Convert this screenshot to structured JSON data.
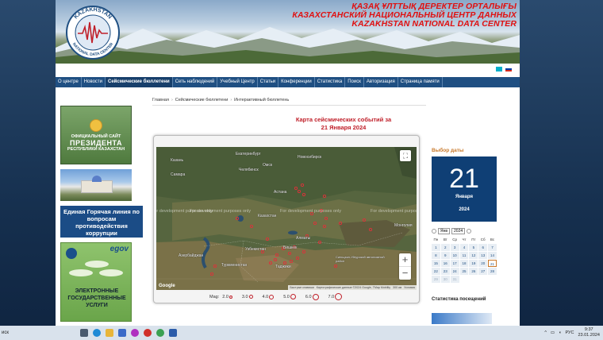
{
  "header": {
    "title_kz": "ҚАЗАҚ ҰЛТТЫҚ ДЕРЕКТЕР ОРТАЛЫҒЫ",
    "title_ru": "КАЗАХСТАНСКИЙ НАЦИОНАЛЬНЫЙ ЦЕНТР ДАННЫХ",
    "title_en": "KAZAKHSTAN NATIONAL DATA CENTER",
    "logo_top": "KAZAKHSTAN",
    "logo_bottom": "NATIONAL DATA CENTER"
  },
  "nav": {
    "items": [
      {
        "label": "О центре"
      },
      {
        "label": "Новости"
      },
      {
        "label": "Сейсмические бюллетени"
      },
      {
        "label": "Сеть наблюдений"
      },
      {
        "label": "Учебный Центр"
      },
      {
        "label": "Статьи"
      },
      {
        "label": "Конференции"
      },
      {
        "label": "Статистика"
      },
      {
        "label": "Поиск"
      },
      {
        "label": "Авторизация"
      },
      {
        "label": "Страница памяти"
      }
    ]
  },
  "breadcrumb": {
    "home": "Главная",
    "section": "Сейсмические бюллетени",
    "current": "Интерактивный бюллетень"
  },
  "map_title": {
    "line1": "Карта сейсмических событий за",
    "line2": "21 Января 2024"
  },
  "map": {
    "watermark": "For development purposes only",
    "labels": {
      "kazakhstan": "Казахстан",
      "astana": "Астана",
      "uzbekistan": "Узбекистан",
      "turkmenistan": "Туркменистан",
      "azerbaijan": "Азербайджан",
      "tajikistan": "Таджики",
      "almaty": "Алматы",
      "bishkek": "Бишкек",
      "mongolia": "Монголия",
      "novosibirsk": "Новосибирск",
      "omsk": "Омск",
      "yekaterinburg": "Екатеринбург",
      "chelyabinsk": "Челябинск",
      "kazan": "Казань",
      "samara": "Самара",
      "xinjiang": "Синьцзян-Уйгурский автономный район"
    },
    "attribution": {
      "shortcuts": "Быстрые клавиши",
      "data": "Картографические данные ©2024 Google, TMap Mobility",
      "scale": "300 км",
      "terms": "Условия"
    },
    "google": "Google"
  },
  "mag_legend": {
    "label": "Mag:",
    "items": [
      {
        "value": "2.0"
      },
      {
        "value": "3.0"
      },
      {
        "value": "4.0"
      },
      {
        "value": "5.0"
      },
      {
        "value": "6.0"
      },
      {
        "value": "7.0"
      }
    ]
  },
  "date_picker": {
    "title": "Выбор даты",
    "day": "21",
    "month": "Января",
    "year": "2024",
    "month_select": "Янв",
    "year_select": "2024",
    "weekdays": [
      "Пн",
      "Вт",
      "Ср",
      "Чт",
      "Пт",
      "Сб",
      "Вс"
    ],
    "days": [
      "1",
      "2",
      "3",
      "4",
      "5",
      "6",
      "7",
      "8",
      "9",
      "10",
      "11",
      "12",
      "13",
      "14",
      "15",
      "16",
      "17",
      "18",
      "19",
      "20",
      "21",
      "22",
      "23",
      "24",
      "25",
      "26",
      "27",
      "28",
      "29",
      "30",
      "31"
    ]
  },
  "ads": {
    "president_line1": "ОФИЦИАЛЬНЫЙ САЙТ",
    "president_line2": "ПРЕЗИДЕНТА",
    "president_line3": "РЕСПУБЛИКИ КАЗАХСТАН",
    "hotline": "Единая Горячая линия по вопросам противодействия коррупции",
    "egov_brand": "egov",
    "egov_text": "ЭЛЕКТРОННЫЕ ГОСУДАРСТВЕННЫЕ УСЛУГИ"
  },
  "stats_title": "Статистика посещений",
  "taskbar": {
    "search": "иск",
    "lang": "РУС",
    "time": "9:37",
    "date": "23.01.2024"
  },
  "colors": {
    "nav_bg": "#1f4f82",
    "title_red": "#c0202a",
    "date_box": "#0f3f75",
    "accent_orange": "#c8782a"
  }
}
